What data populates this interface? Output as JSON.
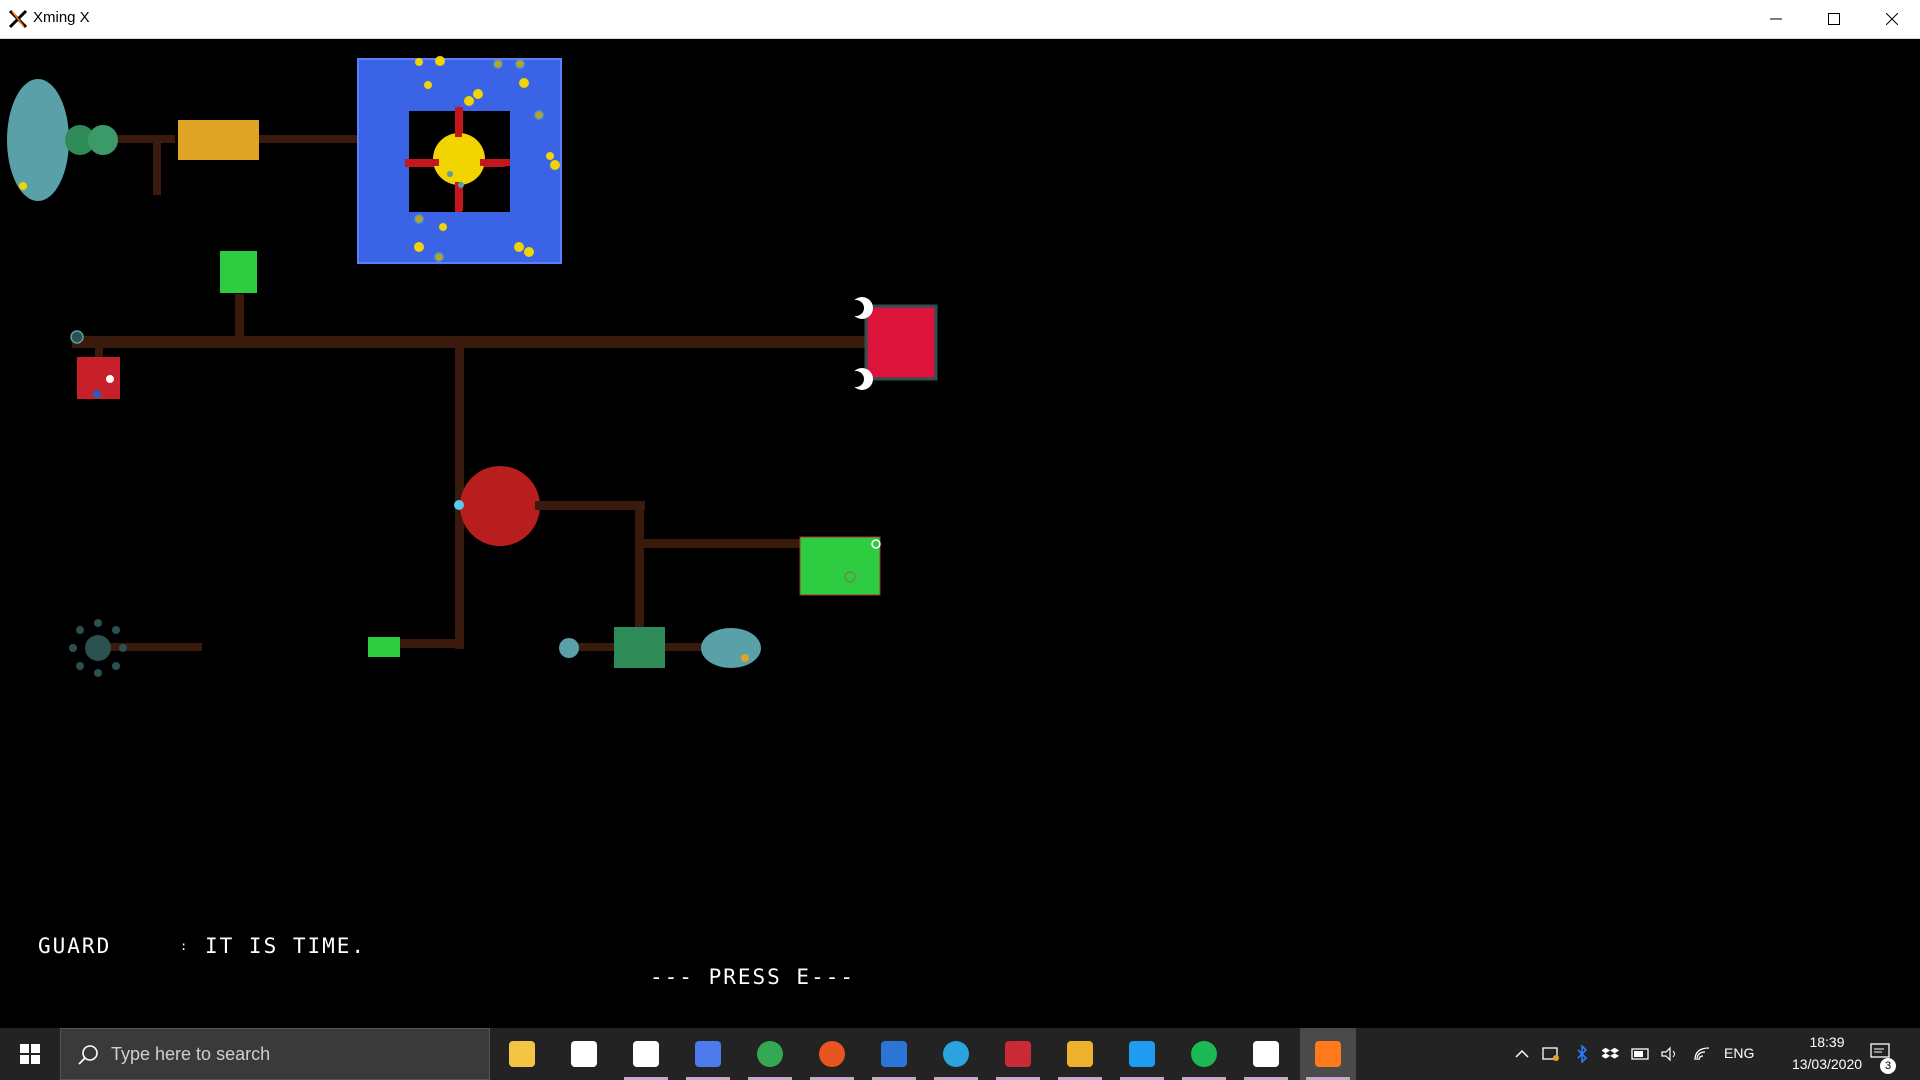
{
  "window": {
    "title": "Xming X"
  },
  "game": {
    "dialogue": {
      "speaker": "GUARD",
      "separator": ":",
      "text": "IT IS TIME."
    },
    "prompt": "--- PRESS E---",
    "colors": {
      "pipe": "#3a1a0c",
      "core_room": "#3a63e6",
      "sun": "#f2d400",
      "cross": "#c4161c",
      "crimson_block": "#dc143c",
      "green_block": "#2ecc40",
      "dark_green": "#2e8b57",
      "teal_oval": "#5aa0a8",
      "gold_box": "#e0a526",
      "red_circle": "#b81e1e",
      "small_red_box": "#c8202a"
    }
  },
  "taskbar": {
    "search_placeholder": "Type here to search",
    "apps": [
      {
        "name": "file-explorer-icon",
        "color": "#f4c542"
      },
      {
        "name": "store-icon",
        "color": "#ffffff"
      },
      {
        "name": "typora-icon",
        "color": "#ffffff"
      },
      {
        "name": "password-manager-icon",
        "color": "#4b7bec"
      },
      {
        "name": "chrome-icon",
        "color": "#34a853"
      },
      {
        "name": "ubuntu-icon",
        "color": "#e95420"
      },
      {
        "name": "thunderbird-icon",
        "color": "#2a75d6"
      },
      {
        "name": "telegram-icon",
        "color": "#2aa3df"
      },
      {
        "name": "zotero-icon",
        "color": "#cc2936"
      },
      {
        "name": "slack-icon",
        "color": "#ecb22e"
      },
      {
        "name": "vscode-icon",
        "color": "#1f9cf0"
      },
      {
        "name": "spotify-icon",
        "color": "#1db954"
      },
      {
        "name": "settings-icon",
        "color": "#ffffff"
      },
      {
        "name": "xming-icon",
        "color": "#ff7a1a"
      }
    ],
    "tray": {
      "language": "ENG",
      "time": "18:39",
      "date": "13/03/2020",
      "notifications": "3"
    }
  }
}
